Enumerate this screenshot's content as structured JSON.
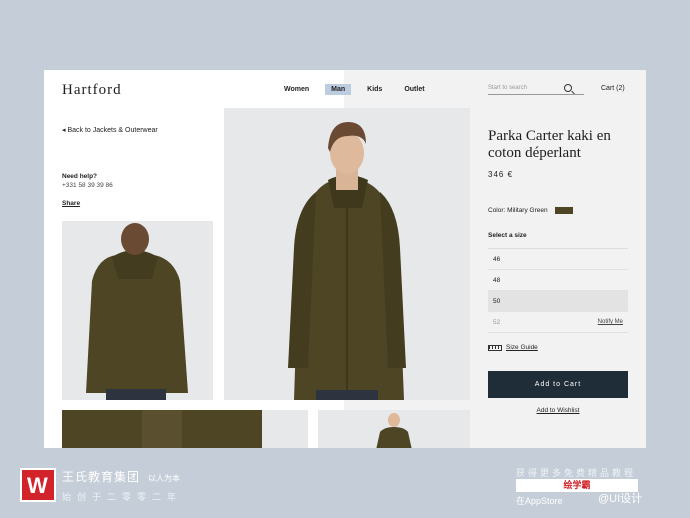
{
  "brand": {
    "logo": "Hartford"
  },
  "nav": {
    "items": [
      "Women",
      "Man",
      "Kids",
      "Outlet"
    ],
    "active_index": 1
  },
  "search": {
    "placeholder": "Start to search"
  },
  "cart": {
    "label": "Cart (2)"
  },
  "breadcrumb": {
    "back_label": "Back to Jackets & Outerwear"
  },
  "help": {
    "title": "Need help?",
    "phone": "+331 58 39 39 86",
    "share": "Share"
  },
  "product": {
    "title": "Parka Carter kaki en coton déperlant",
    "price": "346 €",
    "color_label": "Color: Military Green",
    "color_hex": "#4e4525",
    "size_title": "Select a size",
    "sizes": [
      {
        "label": "46",
        "state": "available",
        "notify": ""
      },
      {
        "label": "48",
        "state": "available",
        "notify": ""
      },
      {
        "label": "50",
        "state": "selected",
        "notify": ""
      },
      {
        "label": "52",
        "state": "disabled",
        "notify": "Notify Me"
      }
    ],
    "size_guide": "Size Guide",
    "add_to_cart": "Add to Cart",
    "add_to_wishlist": "Add to Wishlist"
  },
  "footer": {
    "brand": "王氏教育集团",
    "slogan": "以人为本",
    "founded": "始创于二零零二年",
    "promo": "获得更多免费精品教程",
    "red_badge": "绘学霸",
    "appstore": "在AppStore",
    "watermark": "@UI设计"
  },
  "colors": {
    "accent": "#1f2d38",
    "nav_active": "#bccde0",
    "garment": "#4e4525"
  }
}
